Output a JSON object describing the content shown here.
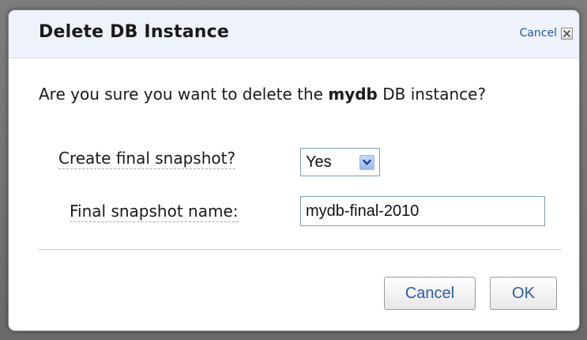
{
  "dialog": {
    "title": "Delete DB Instance",
    "header_cancel_label": "Cancel",
    "message_before": "Are you sure you want to delete the ",
    "instance_name": "mydb",
    "message_after": " DB instance?",
    "final_snapshot_label": "Create final snapshot?",
    "final_snapshot_value": "Yes",
    "final_snapshot_options": [
      "Yes"
    ],
    "snapshot_name_label": "Final snapshot name:",
    "snapshot_name_value": "mydb-final-2010",
    "cancel_button": "Cancel",
    "ok_button": "OK"
  },
  "icons": {
    "header_close": "close-icon",
    "dropdown": "chevron-down-icon"
  },
  "colors": {
    "link": "#1f55a6",
    "button_text": "#2b5aa8",
    "titlebar_bg": "#eef3fb",
    "input_border": "#7f9db9",
    "dropdown_arrow_bg": "#9bb9f0"
  }
}
